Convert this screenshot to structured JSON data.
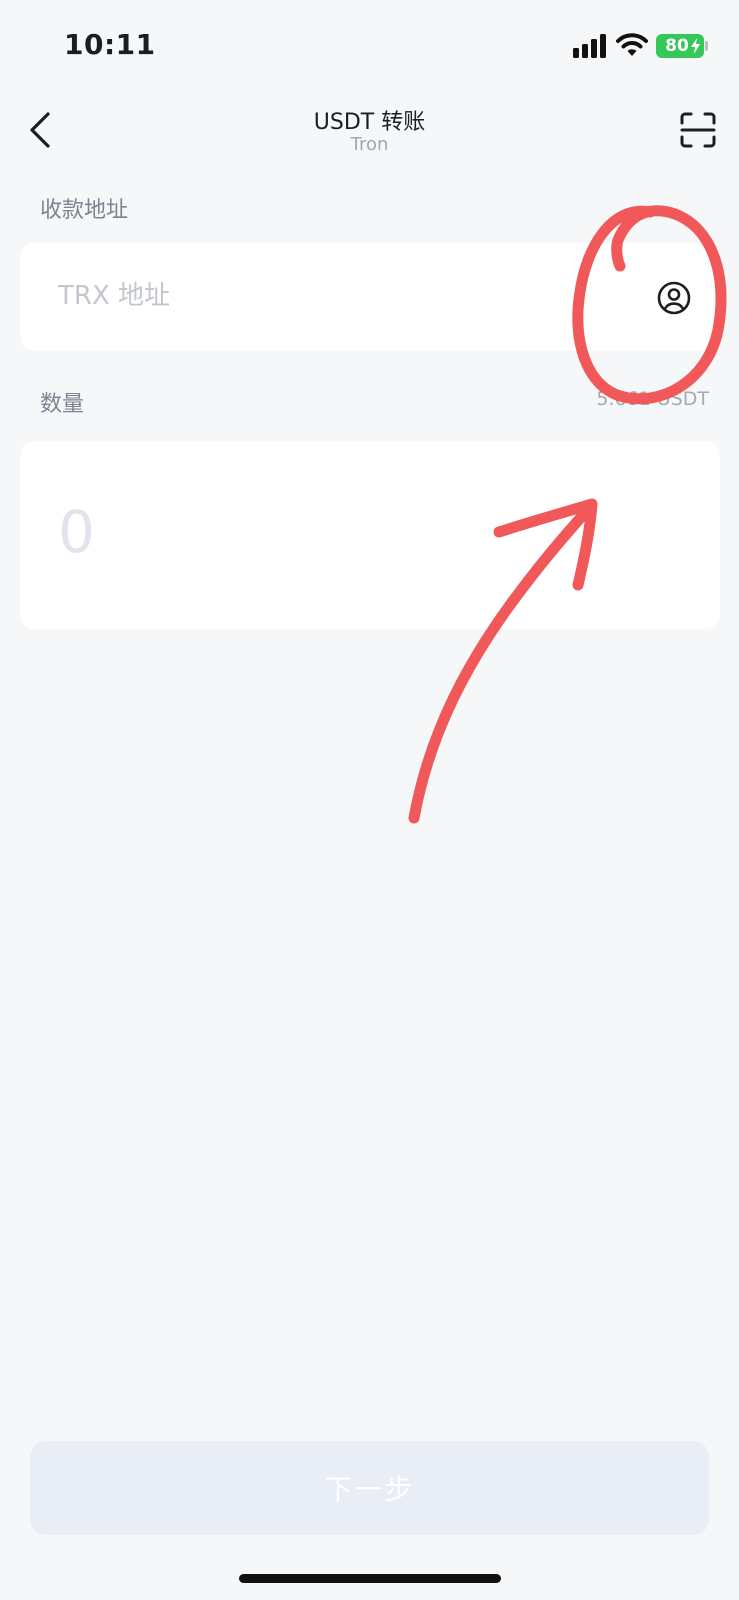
{
  "status_bar": {
    "time": "10:11",
    "battery": "80",
    "signal_icon": "cellular-signal-icon",
    "wifi_icon": "wifi-icon",
    "battery_icon": "battery-charging-icon"
  },
  "header": {
    "title": "USDT 转账",
    "subtitle": "Tron",
    "back_icon": "chevron-left-icon",
    "scan_icon": "scan-icon"
  },
  "address": {
    "label": "收款地址",
    "value": "",
    "placeholder": "TRX 地址",
    "contacts_icon": "user-circle-icon"
  },
  "amount": {
    "label": "数量",
    "balance": "5.661 USDT",
    "value": "",
    "placeholder": "0"
  },
  "footer": {
    "next_label": "下一步"
  },
  "colors": {
    "background": "#f5f7f8",
    "card": "#ffffff",
    "button_disabled": "#e9edf5",
    "annotation": "#f0585a",
    "battery": "#34c759"
  }
}
